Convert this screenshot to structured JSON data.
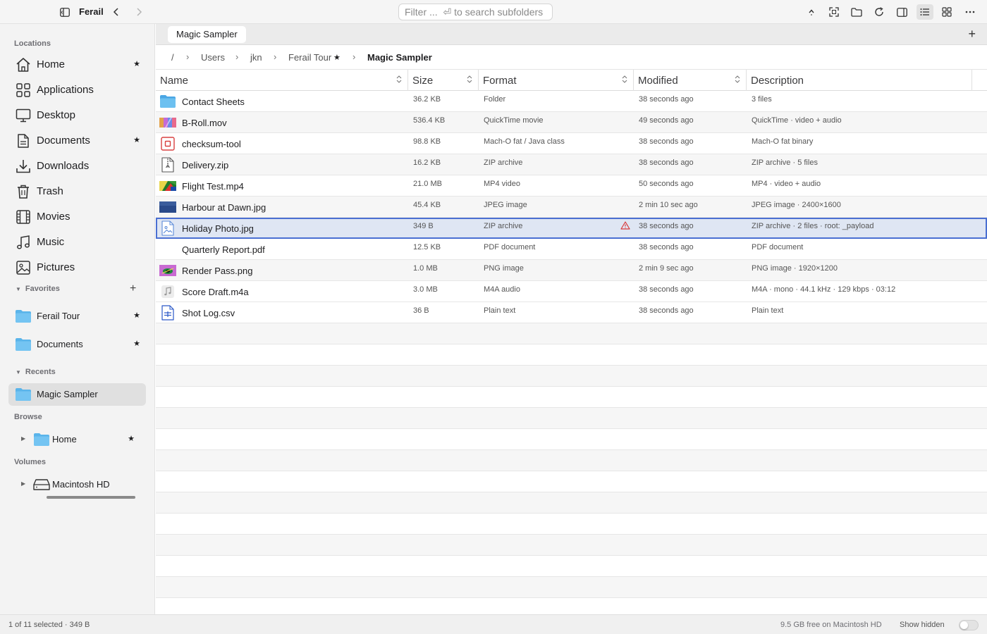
{
  "app": {
    "title": "Ferail"
  },
  "search": {
    "placeholder": "Filter ...  ⏎ to search subfolders"
  },
  "tab": {
    "label": "Magic Sampler",
    "add": "+"
  },
  "sidebar": {
    "locations_header": "Locations",
    "locations": [
      {
        "label": "Home",
        "icon": "home-icon",
        "starred": true
      },
      {
        "label": "Applications",
        "icon": "grid-icon",
        "starred": false
      },
      {
        "label": "Desktop",
        "icon": "monitor-icon",
        "starred": false
      },
      {
        "label": "Documents",
        "icon": "document-icon",
        "starred": true
      },
      {
        "label": "Downloads",
        "icon": "download-icon",
        "starred": false
      },
      {
        "label": "Trash",
        "icon": "trash-icon",
        "starred": false
      },
      {
        "label": "Movies",
        "icon": "film-icon",
        "starred": false
      },
      {
        "label": "Music",
        "icon": "music-note-icon",
        "starred": false
      },
      {
        "label": "Pictures",
        "icon": "picture-icon",
        "starred": false
      }
    ],
    "favorites_header": "Favorites",
    "favorites": [
      {
        "label": "Ferail Tour",
        "starred": true
      },
      {
        "label": "Documents",
        "starred": true
      }
    ],
    "recents_header": "Recents",
    "recents": [
      {
        "label": "Magic Sampler"
      }
    ],
    "browse_header": "Browse",
    "browse": [
      {
        "label": "Home",
        "starred": true
      }
    ],
    "volumes_header": "Volumes",
    "volumes": [
      {
        "label": "Macintosh HD"
      }
    ],
    "star": "★"
  },
  "breadcrumb": {
    "items": [
      "/",
      "Users",
      "jkn",
      "Ferail Tour",
      "Magic Sampler"
    ],
    "separator": "›",
    "starred_item": "Ferail Tour"
  },
  "table": {
    "columns": [
      "Name",
      "Size",
      "Format",
      "Modified",
      "Description"
    ],
    "rows": [
      {
        "name": "Contact Sheets",
        "size": "36.2 KB",
        "format": "Folder",
        "modified": "38 seconds ago",
        "description": "3 files",
        "icon": "folder-icon"
      },
      {
        "name": "B-Roll.mov",
        "size": "536.4 KB",
        "format": "QuickTime movie",
        "modified": "49 seconds ago",
        "description": "QuickTime · video + audio",
        "icon": "movie-thumbnail-icon"
      },
      {
        "name": "checksum-tool",
        "size": "98.8 KB",
        "format": "Mach-O fat / Java class",
        "modified": "38 seconds ago",
        "description": "Mach-O fat binary",
        "icon": "executable-icon"
      },
      {
        "name": "Delivery.zip",
        "size": "16.2 KB",
        "format": "ZIP archive",
        "modified": "38 seconds ago",
        "description": "ZIP archive · 5 files",
        "icon": "zip-icon"
      },
      {
        "name": "Flight Test.mp4",
        "size": "21.0 MB",
        "format": "MP4 video",
        "modified": "50 seconds ago",
        "description": "MP4 · video + audio",
        "icon": "video-thumbnail-icon"
      },
      {
        "name": "Harbour at Dawn.jpg",
        "size": "45.4 KB",
        "format": "JPEG image",
        "modified": "2 min 10 sec ago",
        "description": "JPEG image · 2400×1600",
        "icon": "image-thumbnail-icon"
      },
      {
        "name": "Holiday Photo.jpg",
        "size": "349 B",
        "format": "ZIP archive",
        "modified": "38 seconds ago",
        "description": "ZIP archive · 2 files · root: _payload",
        "icon": "image-file-icon",
        "warning": true,
        "selected": true
      },
      {
        "name": "Quarterly Report.pdf",
        "size": "12.5 KB",
        "format": "PDF document",
        "modified": "38 seconds ago",
        "description": "PDF document",
        "icon": "pdf-icon"
      },
      {
        "name": "Render Pass.png",
        "size": "1.0 MB",
        "format": "PNG image",
        "modified": "2 min 9 sec ago",
        "description": "PNG image · 1920×1200",
        "icon": "png-thumbnail-icon"
      },
      {
        "name": "Score Draft.m4a",
        "size": "3.0 MB",
        "format": "M4A audio",
        "modified": "38 seconds ago",
        "description": "M4A · mono · 44.1 kHz · 129 kbps · 03:12",
        "icon": "audio-file-icon"
      },
      {
        "name": "Shot Log.csv",
        "size": "36 B",
        "format": "Plain text",
        "modified": "38 seconds ago",
        "description": "Plain text",
        "icon": "text-file-icon"
      }
    ]
  },
  "status": {
    "selection": "1 of 11 selected · 349 B",
    "free_space": "9.5 GB free on Macintosh HD",
    "show_hidden_label": "Show hidden",
    "show_hidden": false
  },
  "colors": {
    "selection_border": "#4a6fd2",
    "selection_fill": "#dfe6f3",
    "folder_blue": "#5ab4ea",
    "warning_red": "#d93a3a"
  }
}
